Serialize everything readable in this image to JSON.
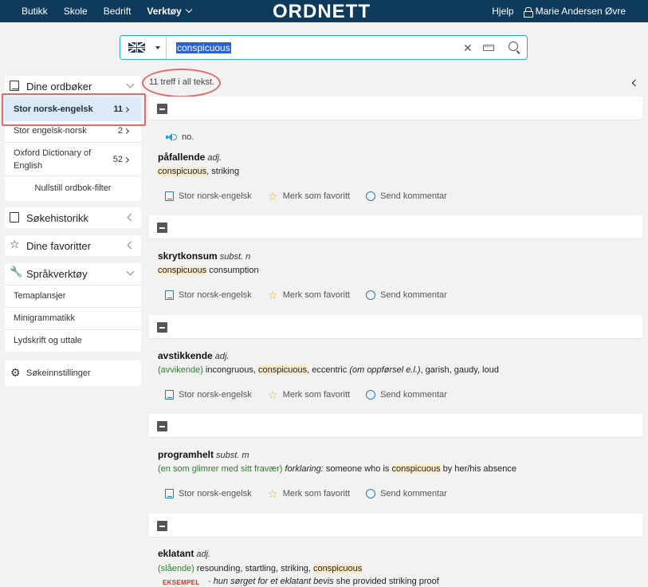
{
  "topbar": {
    "nav": [
      "Butikk",
      "Skole",
      "Bedrift"
    ],
    "tools": "Verktøy",
    "logo": "ORDNETT",
    "help": "Hjelp",
    "user": "Marie Andersen Øvre"
  },
  "search": {
    "language_icon": "uk-flag-icon",
    "query": "conspicuous"
  },
  "sidebar": {
    "dictionaries": {
      "title": "Dine ordbøker",
      "items": [
        {
          "label": "Stor norsk-engelsk",
          "count": "11",
          "selected": true
        },
        {
          "label": "Stor engelsk-norsk",
          "count": "2"
        },
        {
          "label_line1": "Oxford Dictionary of",
          "label_line2": "English",
          "count": "52"
        }
      ],
      "reset": "Nullstill ordbok-filter"
    },
    "history": "Søkehistorikk",
    "favorites": "Dine favoritter",
    "tools": {
      "title": "Språkverktøy",
      "items": [
        "Temaplansjer",
        "Minigrammatikk",
        "Lydskrift og uttale"
      ]
    },
    "settings": "Søkeinnstillinger"
  },
  "results": {
    "count_text": "11 treff i all tekst.",
    "actions": {
      "dict": "Stor norsk-engelsk",
      "fav": "Merk som favoritt",
      "comment": "Send kommentar"
    },
    "entries": [
      {
        "audio": "no.",
        "headword": "påfallende",
        "pos": "adj.",
        "hl": "conspicuous",
        "rest": ", striking"
      },
      {
        "headword": "skrytkonsum",
        "pos": "subst. n",
        "hl": "conspicuous",
        "rest": " consumption"
      },
      {
        "headword": "avstikkende",
        "pos": "adj.",
        "pre_green": "(avvikende)",
        "pre": " incongruous, ",
        "hl": "conspicuous",
        "post1": ", eccentric ",
        "post_it": "(om oppførsel e.l.)",
        "post2": ", garish, gaudy, loud"
      },
      {
        "headword": "programhelt",
        "pos": "subst. m",
        "pre_green": "(en som glimrer med sitt fravær)",
        "it": " forklaring:",
        "pre": " someone who is ",
        "hl": "conspicuous",
        "rest": " by her/his absence"
      },
      {
        "headword": "eklatant",
        "pos": "adj.",
        "pre_green": "(slående)",
        "pre": " resounding, startling, striking, ",
        "hl": "conspicuous",
        "example_tag": "EKSEMPEL",
        "example_it": "· hun sørget for et eklatant bevis",
        "example_tr": " she provided striking proof"
      }
    ]
  }
}
